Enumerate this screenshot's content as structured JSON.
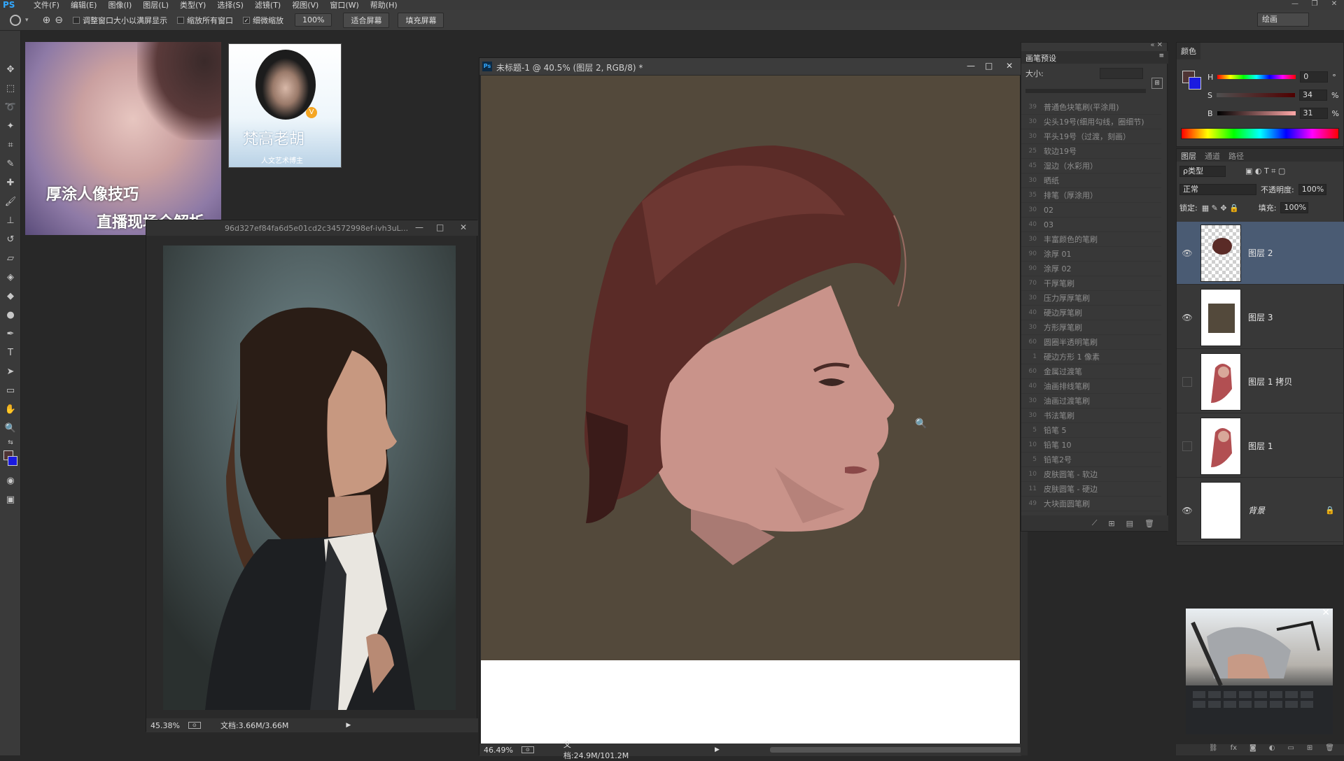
{
  "app": {
    "logo": "PS"
  },
  "menu": [
    "文件(F)",
    "编辑(E)",
    "图像(I)",
    "图层(L)",
    "类型(Y)",
    "选择(S)",
    "滤镜(T)",
    "视图(V)",
    "窗口(W)",
    "帮助(H)"
  ],
  "options": {
    "chk_resize": "调整窗口大小以满屏显示",
    "chk_all": "缩放所有窗口",
    "chk_scrubby": "细微缩放",
    "btn_100": "100%",
    "btn_fit": "适合屏幕",
    "btn_fill": "填充屏幕",
    "workspace": "绘画"
  },
  "thumbs": {
    "art_line1": "厚涂人像技巧",
    "art_line2": "直播现场全解析",
    "profile_name": "梵高老胡",
    "profile_sub": "人文艺术博主"
  },
  "ref_window": {
    "title": "96d327ef84fa6d5e01cd2c34572998ef-ivh3uL...",
    "zoom": "45.38%",
    "doc": "文档:3.66M/3.66M"
  },
  "main_window": {
    "title": "未标题-1 @ 40.5% (图层 2, RGB/8) *",
    "zoom": "46.49%",
    "doc": "文档:24.9M/101.2M"
  },
  "brush_panel": {
    "tab": "画笔预设",
    "size_label": "大小:",
    "items": [
      {
        "num": "39",
        "name": "普通色块笔刷(平涂用)"
      },
      {
        "num": "30",
        "name": "尖头19号(细用勾线，圈细节)"
      },
      {
        "num": "30",
        "name": "平头19号（过渡，刻画）"
      },
      {
        "num": "25",
        "name": "软边19号"
      },
      {
        "num": "45",
        "name": "湿边（水彩用）"
      },
      {
        "num": "30",
        "name": "晒纸"
      },
      {
        "num": "35",
        "name": "排笔（厚涂用）"
      },
      {
        "num": "30",
        "name": "02"
      },
      {
        "num": "40",
        "name": "03"
      },
      {
        "num": "30",
        "name": "丰富颜色的笔刷"
      },
      {
        "num": "90",
        "name": "涂厚 01"
      },
      {
        "num": "90",
        "name": "涂厚 02"
      },
      {
        "num": "70",
        "name": "干厚笔刷"
      },
      {
        "num": "30",
        "name": "压力厚厚笔刷"
      },
      {
        "num": "40",
        "name": "硬边厚笔刷"
      },
      {
        "num": "30",
        "name": "方形厚笔刷"
      },
      {
        "num": "60",
        "name": "圆圈半透明笔刷"
      },
      {
        "num": "1",
        "name": "硬边方形 1 像素"
      },
      {
        "num": "60",
        "name": "金属过渡笔"
      },
      {
        "num": "40",
        "name": "油画排线笔刷"
      },
      {
        "num": "30",
        "name": "油画过渡笔刷"
      },
      {
        "num": "30",
        "name": "书法笔刷"
      },
      {
        "num": "5",
        "name": "铅笔 5"
      },
      {
        "num": "10",
        "name": "铅笔 10"
      },
      {
        "num": "5",
        "name": "铅笔2号"
      },
      {
        "num": "10",
        "name": "皮肤圆笔 - 软边"
      },
      {
        "num": "11",
        "name": "皮肤圆笔 - 硬边"
      },
      {
        "num": "49",
        "name": "大块面圆笔刷"
      }
    ]
  },
  "color_panel": {
    "tab": "颜色",
    "h_label": "H",
    "h_value": "0",
    "h_unit": "°",
    "s_label": "S",
    "s_value": "34",
    "s_unit": "%",
    "b_label": "B",
    "b_value": "31",
    "b_unit": "%",
    "fg_color": "#4f3434",
    "bg_color": "#1a1adf"
  },
  "layers_panel": {
    "tabs": [
      "图层",
      "通道",
      "路径"
    ],
    "filter": "ρ类型",
    "blend_mode": "正常",
    "opacity_label": "不透明度:",
    "opacity": "100%",
    "lock_label": "锁定:",
    "fill_label": "填充:",
    "fill": "100%",
    "layers": [
      {
        "name": "图层 2",
        "selected": true,
        "visible": true
      },
      {
        "name": "图层 3",
        "selected": false,
        "visible": true
      },
      {
        "name": "图层 1 拷贝",
        "selected": false,
        "visible": false
      },
      {
        "name": "图层 1",
        "selected": false,
        "visible": false
      },
      {
        "name": "背景",
        "selected": false,
        "visible": true,
        "locked": true
      }
    ]
  }
}
